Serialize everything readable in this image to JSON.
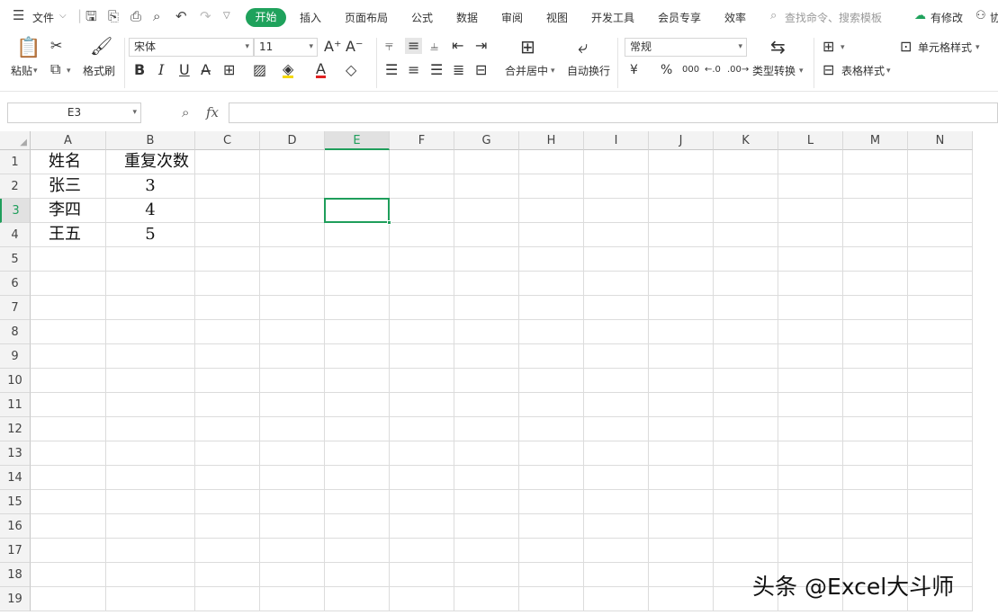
{
  "topbar": {
    "file_label": "文件",
    "tabs": [
      "开始",
      "插入",
      "页面布局",
      "公式",
      "数据",
      "审阅",
      "视图",
      "开发工具",
      "会员专享",
      "效率"
    ],
    "search_placeholder": "查找命令、搜索模板",
    "modify_label": "有修改",
    "collab_label": "协"
  },
  "ribbon": {
    "paste_label": "粘贴",
    "format_painter_label": "格式刷",
    "font_name": "宋体",
    "font_size": "11",
    "bold_label": "B",
    "italic_label": "I",
    "underline_label": "U",
    "merge_center_label": "合并居中",
    "wrap_text_label": "自动换行",
    "number_format": "常规",
    "currency_label": "¥",
    "percent_label": "%",
    "thousands_label": "000",
    "type_convert_label": "类型转换",
    "cell_style_label": "单元格样式",
    "table_style_label": "表格样式"
  },
  "formula_bar": {
    "name_box": "E3",
    "fx_label": "fx",
    "formula_value": ""
  },
  "sheet": {
    "columns": [
      "A",
      "B",
      "C",
      "D",
      "E",
      "F",
      "G",
      "H",
      "I",
      "J",
      "K",
      "L",
      "M",
      "N"
    ],
    "rows": [
      "1",
      "2",
      "3",
      "4",
      "5",
      "6",
      "7",
      "8",
      "9",
      "10",
      "11",
      "12",
      "13",
      "14",
      "15",
      "16",
      "17",
      "18",
      "19"
    ],
    "selected_cell": "E3",
    "cells": {
      "A1": "姓名",
      "B1": "重复次数",
      "A2": "张三",
      "B2": "3",
      "A3": "李四",
      "B3": "4",
      "A4": "王五",
      "B4": "5"
    }
  },
  "watermark": "头条 @Excel大斗师",
  "colors": {
    "accent": "#1fa25c",
    "selection": "#1f9e5b"
  }
}
